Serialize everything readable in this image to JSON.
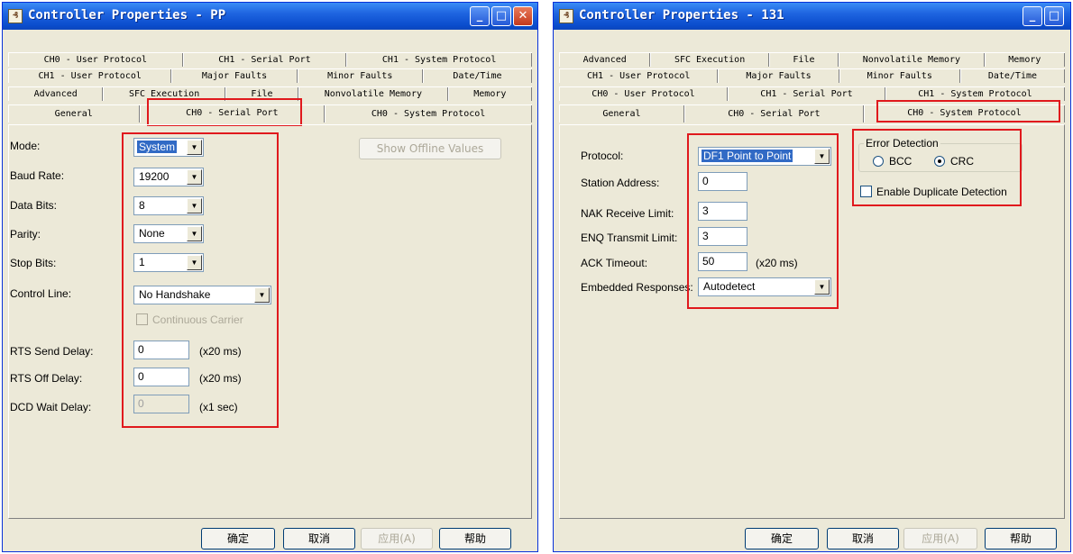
{
  "left_window": {
    "title": "Controller Properties - PP",
    "title_icon_glyph": "₰",
    "tab_rows": [
      [
        "CH0 - User Protocol",
        "CH1 - Serial Port",
        "CH1 - System Protocol"
      ],
      [
        "CH1 - User Protocol",
        "Major Faults",
        "Minor Faults",
        "Date/Time"
      ],
      [
        "Advanced",
        "SFC Execution",
        "File",
        "Nonvolatile Memory",
        "Memory"
      ],
      [
        "General",
        "CH0 - Serial Port",
        "CH0 - System Protocol"
      ]
    ],
    "active_tab": "CH0 - Serial Port",
    "show_offline_values": "Show Offline Values",
    "fields": {
      "mode": {
        "label": "Mode:",
        "value": "System"
      },
      "baud_rate": {
        "label": "Baud Rate:",
        "value": "19200"
      },
      "data_bits": {
        "label": "Data Bits:",
        "value": "8"
      },
      "parity": {
        "label": "Parity:",
        "value": "None"
      },
      "stop_bits": {
        "label": "Stop Bits:",
        "value": "1"
      },
      "control_line": {
        "label": "Control Line:",
        "value": "No Handshake"
      },
      "continuous_carrier": {
        "label": "Continuous Carrier"
      },
      "rts_send_delay": {
        "label": "RTS Send Delay:",
        "value": "0",
        "unit": "(x20 ms)"
      },
      "rts_off_delay": {
        "label": "RTS Off Delay:",
        "value": "0",
        "unit": "(x20 ms)"
      },
      "dcd_wait_delay": {
        "label": "DCD Wait Delay:",
        "value": "0",
        "unit": "(x1 sec)"
      }
    },
    "buttons": {
      "ok": "确定",
      "cancel": "取消",
      "apply": "应用(A)",
      "help": "帮助"
    }
  },
  "right_window": {
    "title": "Controller Properties - 131",
    "title_icon_glyph": "₰",
    "tab_rows": [
      [
        "Advanced",
        "SFC Execution",
        "File",
        "Nonvolatile Memory",
        "Memory"
      ],
      [
        "CH1 - User Protocol",
        "Major Faults",
        "Minor Faults",
        "Date/Time"
      ],
      [
        "CH0 - User Protocol",
        "CH1 - Serial Port",
        "CH1 - System Protocol"
      ],
      [
        "General",
        "CH0 - Serial Port",
        "CH0 - System Protocol"
      ]
    ],
    "active_tab": "CH0 - System Protocol",
    "fields": {
      "protocol": {
        "label": "Protocol:",
        "value": "DF1 Point to Point"
      },
      "station_address": {
        "label": "Station Address:",
        "value": "0"
      },
      "nak_receive_limit": {
        "label": "NAK Receive Limit:",
        "value": "3"
      },
      "enq_transmit_limit": {
        "label": "ENQ Transmit Limit:",
        "value": "3"
      },
      "ack_timeout": {
        "label": "ACK Timeout:",
        "value": "50",
        "unit": "(x20 ms)"
      },
      "embedded_responses": {
        "label": "Embedded Responses:",
        "value": "Autodetect"
      }
    },
    "error_detection": {
      "legend": "Error Detection",
      "bcc_label": "BCC",
      "crc_label": "CRC",
      "selected": "CRC"
    },
    "enable_duplicate_detection": "Enable Duplicate Detection",
    "buttons": {
      "ok": "确定",
      "cancel": "取消",
      "apply": "应用(A)",
      "help": "帮助"
    }
  }
}
